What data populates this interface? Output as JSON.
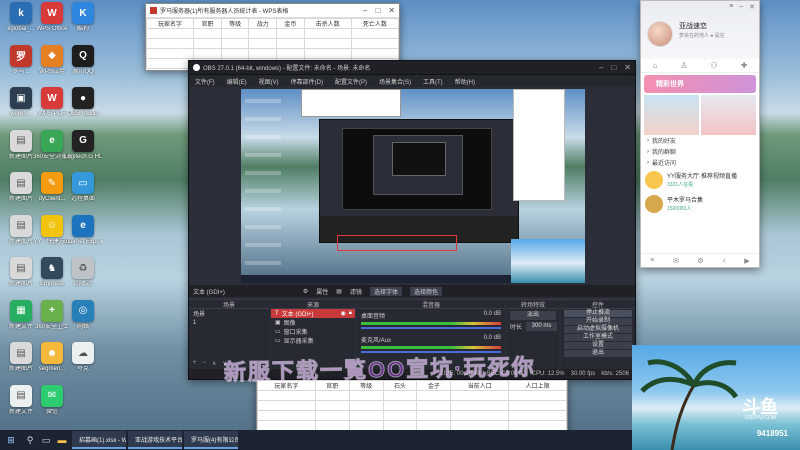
{
  "desktop": {
    "icons": [
      {
        "label": "kglobal_...",
        "color": "#2a6fb4",
        "glyph": "k"
      },
      {
        "label": "WPS Office",
        "color": "#d83a3a",
        "glyph": "W"
      },
      {
        "label": "酷狗",
        "color": "#2e86de",
        "glyph": "K"
      },
      {
        "label": "罗马...",
        "color": "#c0392b",
        "glyph": "罗"
      },
      {
        "label": "WPS应用",
        "color": "#e67e22",
        "glyph": "◆"
      },
      {
        "label": "腾讯QQ",
        "color": "#1d1d1d",
        "glyph": "Q"
      },
      {
        "label": "weixin...",
        "color": "#2d3e50",
        "glyph": "▣"
      },
      {
        "label": "WPS PDF",
        "color": "#d83a3a",
        "glyph": "W"
      },
      {
        "label": "OBS Studio",
        "color": "#222",
        "glyph": "●"
      },
      {
        "label": "新建图片",
        "color": "#d9d9d9",
        "glyph": "▤"
      },
      {
        "label": "360安全浏览器",
        "color": "#3aa757",
        "glyph": "e"
      },
      {
        "label": "Logitech G HUB",
        "color": "#222",
        "glyph": "G"
      },
      {
        "label": "新建图片",
        "color": "#d9d9d9",
        "glyph": "▤"
      },
      {
        "label": "dyClient...",
        "color": "#f39c12",
        "glyph": "✎"
      },
      {
        "label": "远程桌面",
        "color": "#3498db",
        "glyph": "▭"
      },
      {
        "label": "新建图片",
        "color": "#d9d9d9",
        "glyph": "▤"
      },
      {
        "label": "YY - 快捷方式",
        "color": "#f1c40f",
        "glyph": "☺"
      },
      {
        "label": "Internet Explorer",
        "color": "#1e73be",
        "glyph": "e"
      },
      {
        "label": "新建图片",
        "color": "#d9d9d9",
        "glyph": "▤"
      },
      {
        "label": "Empress",
        "color": "#34495e",
        "glyph": "♞"
      },
      {
        "label": "回收站",
        "color": "#bdc3c7",
        "glyph": "♻"
      },
      {
        "label": "新建文件",
        "color": "#27ae60",
        "glyph": "▦"
      },
      {
        "label": "360安全卫士",
        "color": "#6ab04c",
        "glyph": "+"
      },
      {
        "label": "网络",
        "color": "#2980b9",
        "glyph": "◎"
      },
      {
        "label": "新建图片",
        "color": "#d9d9d9",
        "glyph": "▤"
      },
      {
        "label": "segmen...",
        "color": "#f6b93b",
        "glyph": "☻"
      },
      {
        "label": "夸克",
        "color": "#ecf0f1",
        "glyph": "☁"
      },
      {
        "label": "新建文件",
        "color": "#ecf0f1",
        "glyph": "▤"
      },
      {
        "label": "微信",
        "color": "#2ecc71",
        "glyph": "✉"
      }
    ]
  },
  "spreadsheet_top": {
    "title": "罗马服务器(1)所有服务器人员统计表 - WPS表格",
    "headers": [
      "玩家名字",
      "官职",
      "等级",
      "战力",
      "金币",
      "击杀人数",
      "死亡人数"
    ]
  },
  "spreadsheet_bottom": {
    "headers": [
      "玩家名字",
      "官职",
      "等级",
      "石头",
      "金子",
      "当前人口",
      "人口上限"
    ]
  },
  "obs": {
    "title": "OBS 27.0.1 (64-bit, windows) - 配置文件: 未命名 - 场景: 未命名",
    "menu": [
      "文件(F)",
      "编辑(E)",
      "视图(V)",
      "停靠部件(D)",
      "配置文件(P)",
      "场景集合(S)",
      "工具(T)",
      "帮助(H)"
    ],
    "source_bar": {
      "label": "文本 (GDI+)",
      "properties": "属性",
      "filters": "滤镜",
      "font": "选择字体",
      "text": "选择颜色"
    },
    "docks": {
      "scenes": {
        "title": "场景",
        "items": [
          "场景",
          "1"
        ]
      },
      "sources": {
        "title": "来源",
        "items": [
          "文本 (GDI+)",
          "图像",
          "窗口采集",
          "显示器采集"
        ]
      },
      "mixer": {
        "title": "混音器",
        "tracks": [
          {
            "name": "桌面音频",
            "db": "0.0 dB"
          },
          {
            "name": "麦克风/Aux",
            "db": "0.0 dB"
          }
        ]
      },
      "transitions": {
        "title": "转场特效",
        "fade": "淡出",
        "duration_label": "时长",
        "duration": "300 ms"
      },
      "controls": {
        "title": "控件",
        "buttons": [
          "停止推流",
          "开始录制",
          "启动虚拟摄像机",
          "工作室模式",
          "设置",
          "退出"
        ]
      }
    },
    "status": {
      "live": "LIVE: 00:20:48",
      "rec": "REC: 00:00:00",
      "cpu": "CPU: 12.5%",
      "fps": "30.00 fps",
      "kbps": "kb/s: 2506"
    }
  },
  "overlay": {
    "text": "新服下载一覧OO宣坑·玩死你"
  },
  "qq": {
    "name": "亚战速恋",
    "status": "梦余在的地人 ● 是在",
    "menu_items": [
      "我的好友",
      "我的群聊",
      "最近访问"
    ],
    "banner": "精彩世界",
    "contacts": [
      {
        "name": "YY服务大厅·推荐视频直播",
        "sub": "3331人在看"
      },
      {
        "name": "平木罗马合集",
        "sub": "1500083人"
      }
    ]
  },
  "douyu": {
    "logo": "斗鱼",
    "sub": "DOUYU.COM",
    "room": "9418951"
  },
  "taskbar": {
    "apps": [
      {
        "label": "招募画(1).xlsx - W...",
        "color": "#d83a3a"
      },
      {
        "label": "亚战游戏技术平台",
        "color": "#2b6cb0"
      },
      {
        "label": "罗马服(4)有限公司...",
        "color": "#c0392b"
      }
    ]
  }
}
